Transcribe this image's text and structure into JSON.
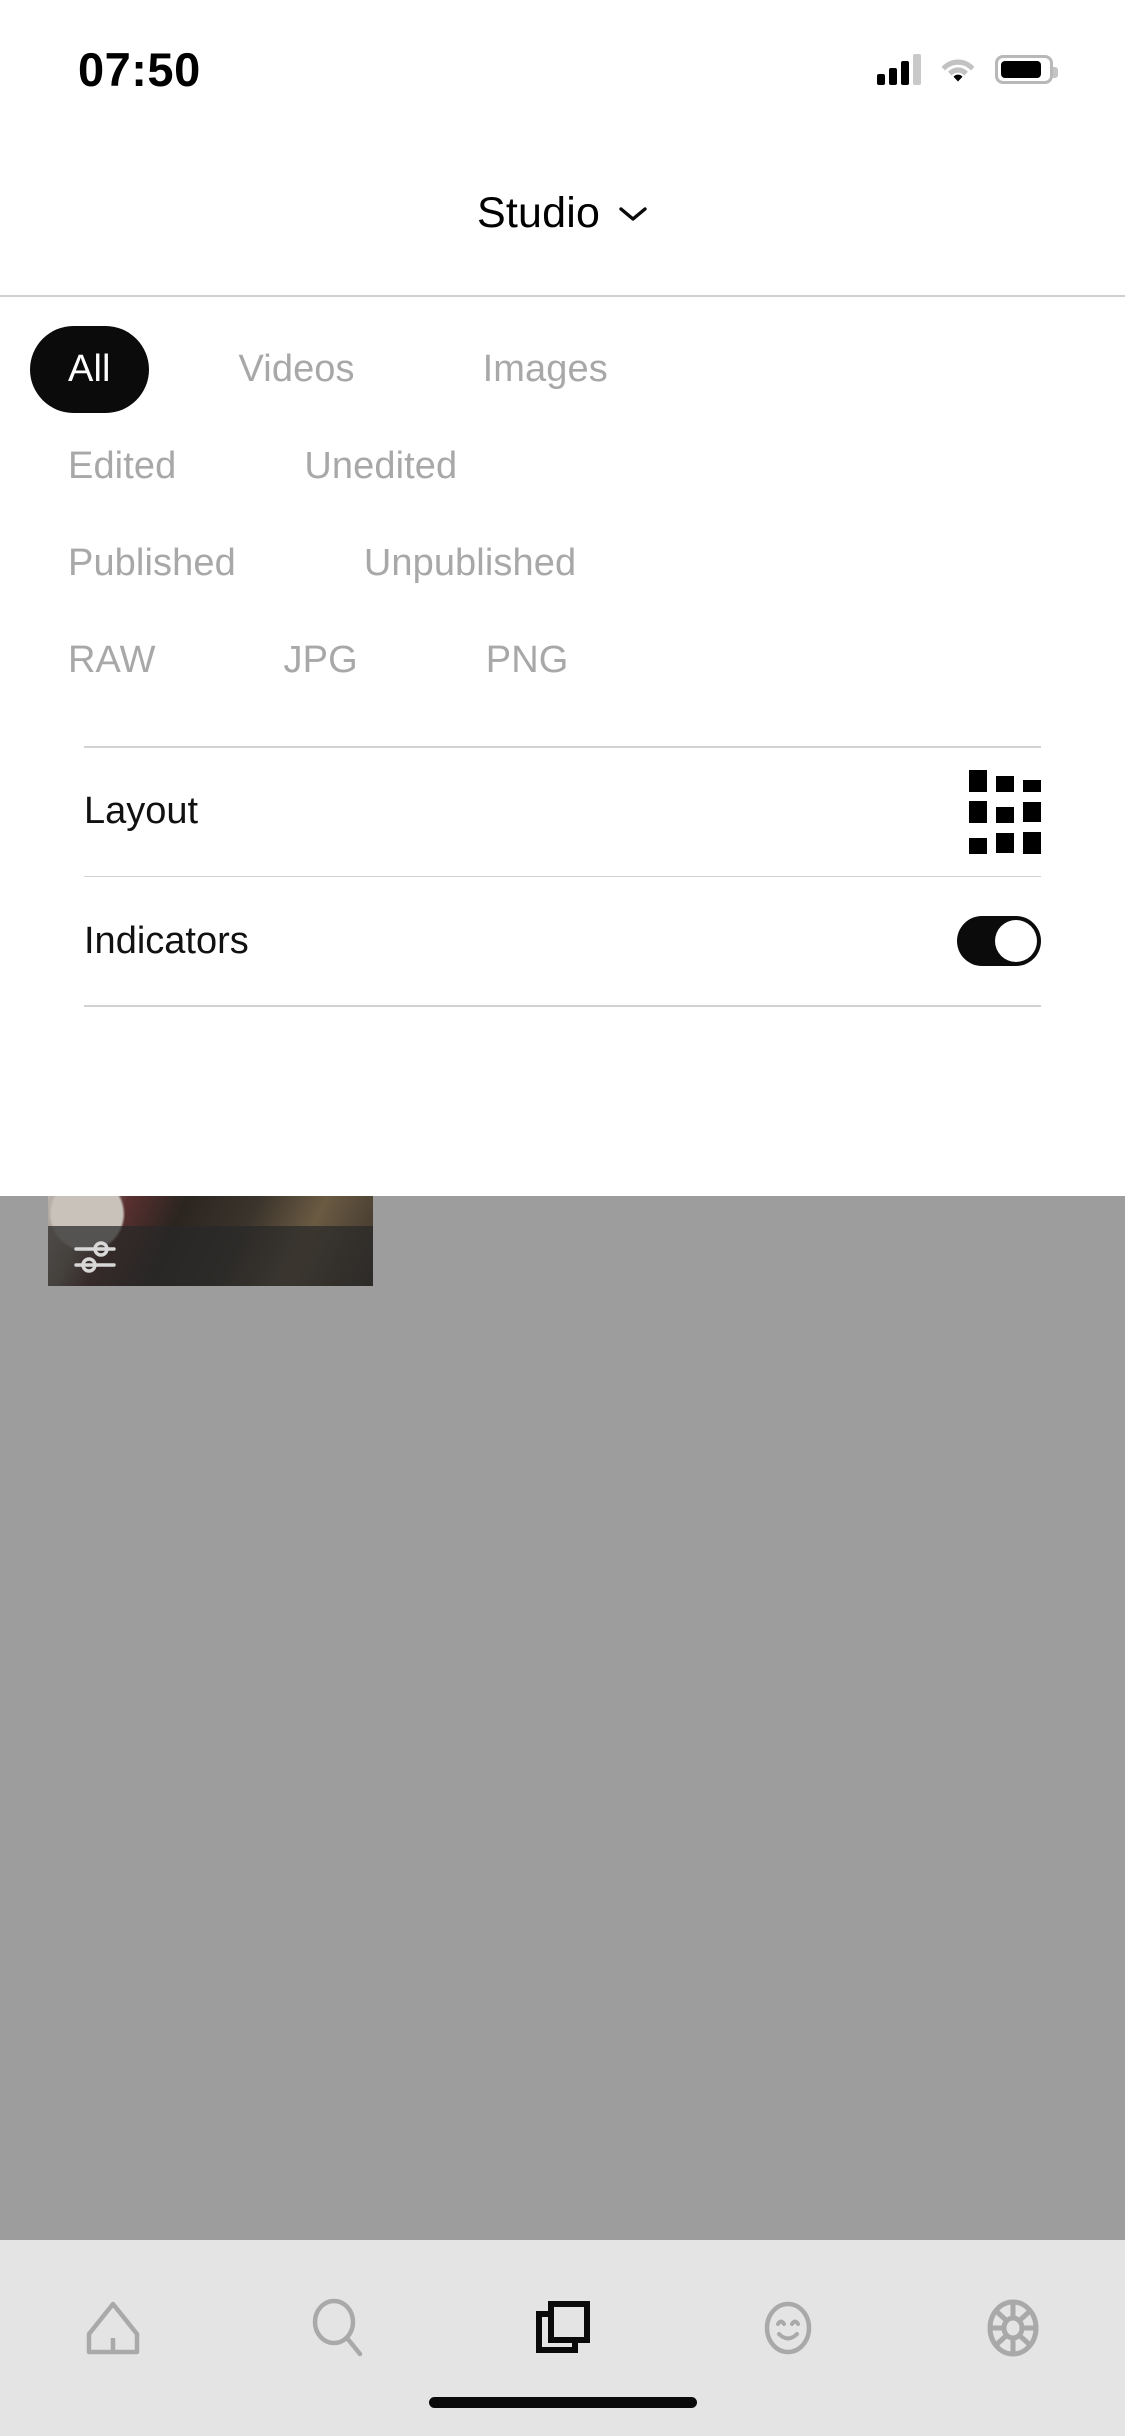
{
  "status_bar": {
    "time": "07:50",
    "signal_icon": "cellular-signal-icon",
    "signal_bars_filled": 3,
    "signal_bars_total": 4,
    "wifi_icon": "wifi-icon",
    "battery_icon": "battery-icon",
    "battery_level_percent": 88
  },
  "header": {
    "title": "Studio",
    "chevron_icon": "chevron-down-icon"
  },
  "filter_panel": {
    "rows": [
      {
        "name": "media-type",
        "chips": [
          {
            "label": "All",
            "active": true
          },
          {
            "label": "Videos",
            "active": false
          },
          {
            "label": "Images",
            "active": false
          }
        ]
      },
      {
        "name": "edit-state",
        "chips": [
          {
            "label": "Edited",
            "active": false
          },
          {
            "label": "Unedited",
            "active": false
          }
        ]
      },
      {
        "name": "publish-state",
        "chips": [
          {
            "label": "Published",
            "active": false
          },
          {
            "label": "Unpublished",
            "active": false
          }
        ]
      },
      {
        "name": "file-format",
        "chips": [
          {
            "label": "RAW",
            "active": false
          },
          {
            "label": "JPG",
            "active": false
          },
          {
            "label": "PNG",
            "active": false
          }
        ]
      }
    ],
    "settings": [
      {
        "name": "layout",
        "label": "Layout",
        "control": "grid-3x3-icon",
        "value": "grid"
      },
      {
        "name": "indicators",
        "label": "Indicators",
        "control": "toggle-switch",
        "value": "on"
      }
    ]
  },
  "gallery": {
    "thumbnail_badge_icon": "sliders-adjustments-icon"
  },
  "tabbar": {
    "items": [
      {
        "label": "Home",
        "icon": "home-icon",
        "active": false
      },
      {
        "label": "Search",
        "icon": "search-icon",
        "active": false
      },
      {
        "label": "Studio",
        "icon": "layers-icon",
        "active": true
      },
      {
        "label": "Profile",
        "icon": "smiley-face-icon",
        "active": false
      },
      {
        "label": "Discover",
        "icon": "wheel-icon",
        "active": false
      }
    ]
  },
  "colors": {
    "accent": "#0b0b0b",
    "chip_inactive_text": "#a8a8a8",
    "backdrop": "#9d9d9d",
    "tabbar_bg": "#e4e4e4",
    "divider": "#d2d2d2"
  }
}
